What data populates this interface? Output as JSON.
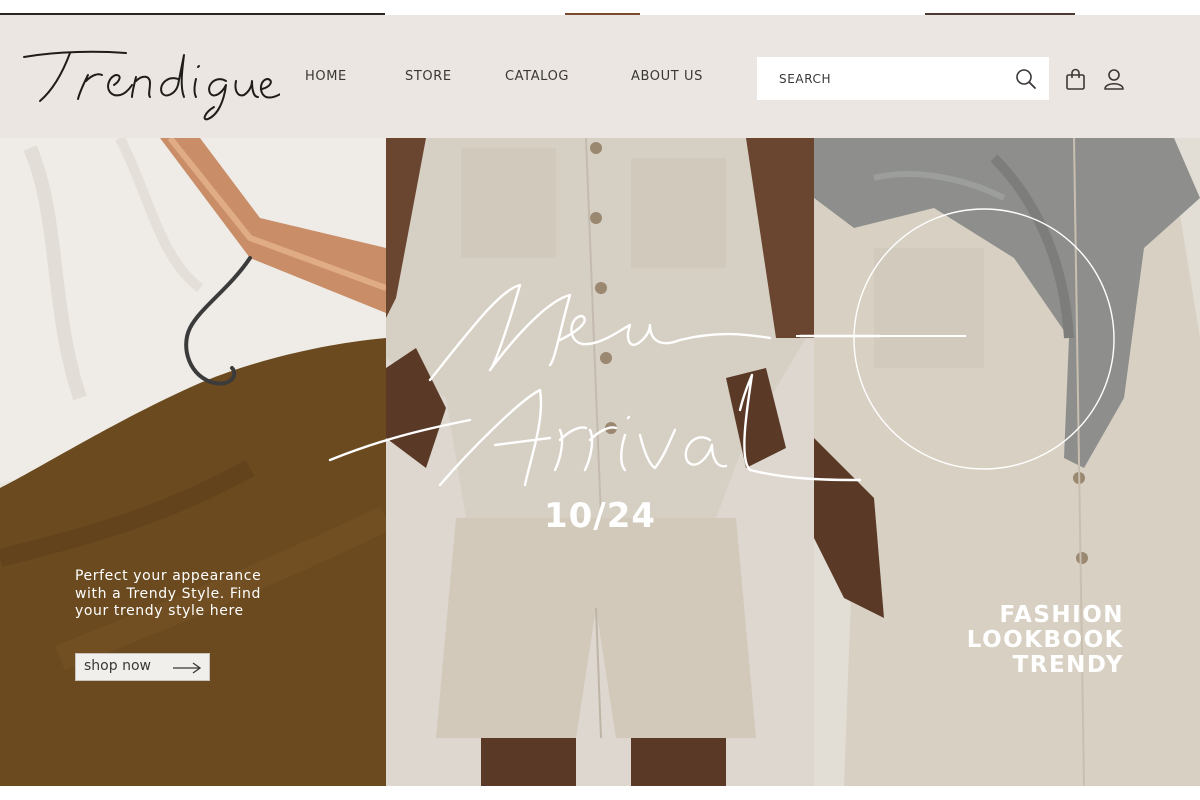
{
  "brand": {
    "logo_text": "Trendique"
  },
  "nav": {
    "items": [
      {
        "label": "HOME"
      },
      {
        "label": "STORE"
      },
      {
        "label": "CATALOG"
      },
      {
        "label": "ABOUT US"
      }
    ]
  },
  "search": {
    "placeholder": "SEARCH"
  },
  "icons": {
    "search": "search-icon",
    "cart": "shopping-bag-icon",
    "account": "user-icon",
    "shop_arrow": "arrow-right-icon"
  },
  "hero": {
    "headline_line1": "New",
    "headline_line2": "Arrival",
    "date": "10/24",
    "promo_text": "Perfect your appearance with a Trendy Style. Find your trendy style here",
    "shop_button": "shop now",
    "tagline": [
      "FASHION",
      "LOOKBOOK",
      "TRENDY"
    ]
  },
  "colors": {
    "header_bg": "#ebe6e1",
    "text_dark": "#3a3735",
    "accent_brown": "#6b4a1f",
    "linen": "#d9d1c4",
    "grey_sweater": "#8e8f8d"
  }
}
